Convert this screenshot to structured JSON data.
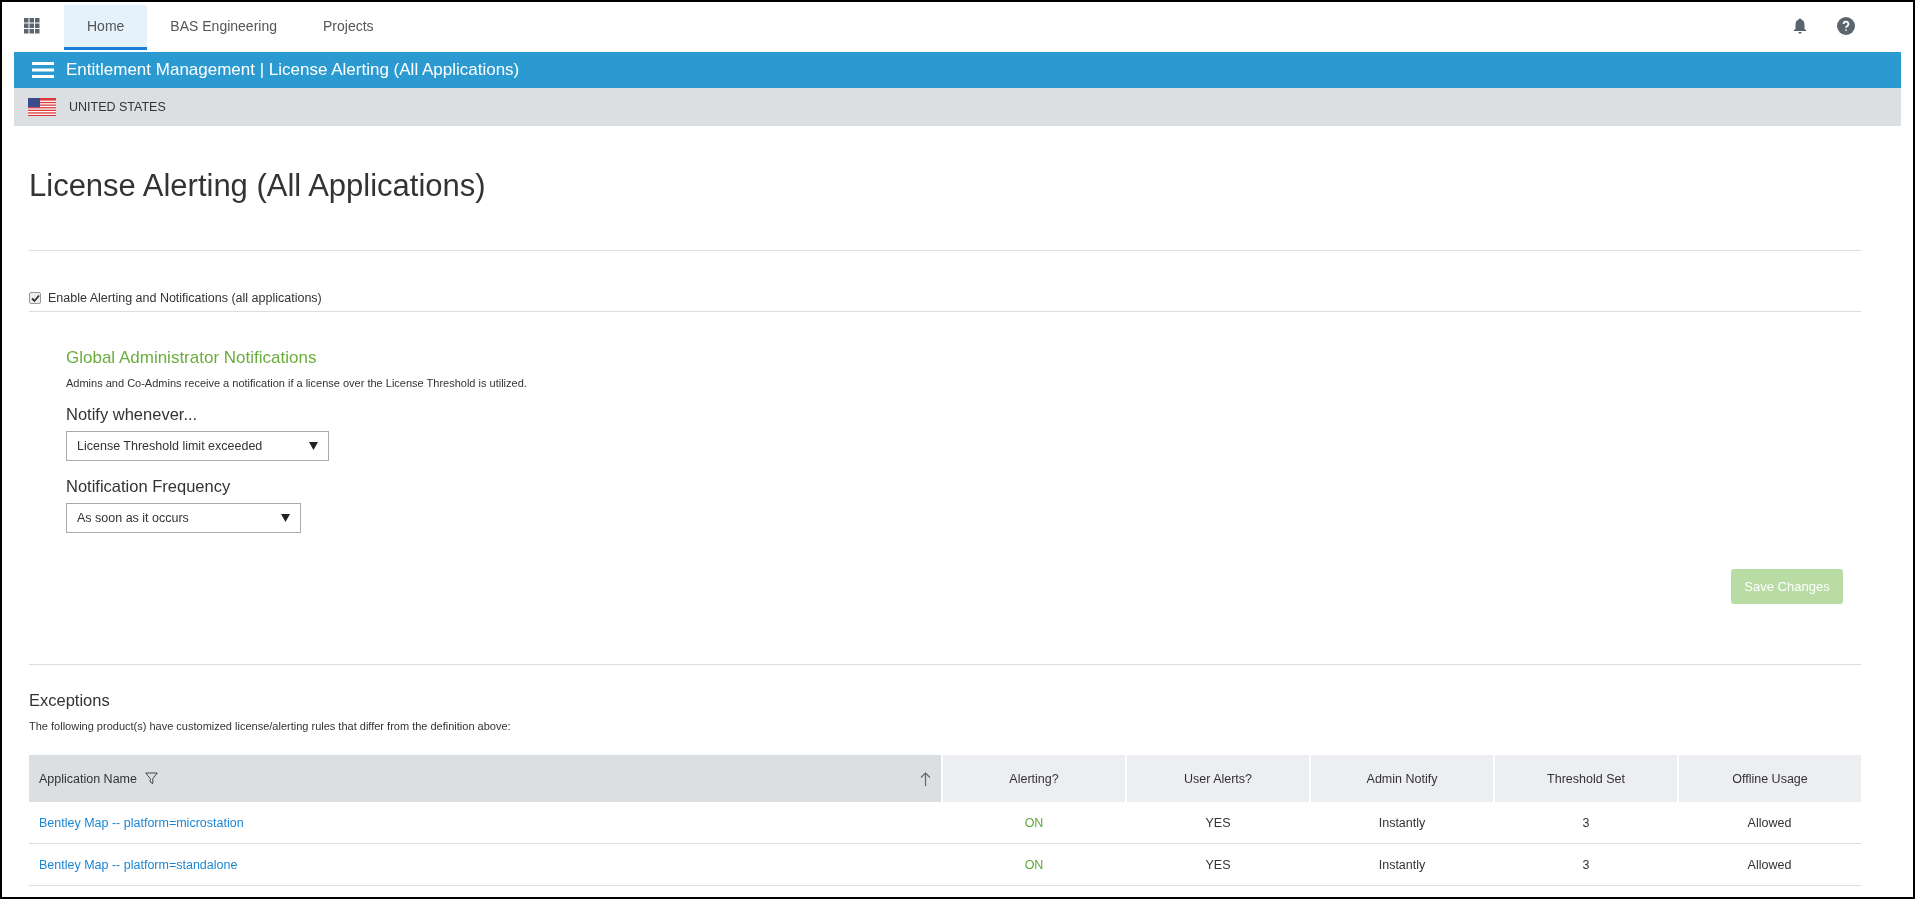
{
  "top_nav": {
    "tabs": [
      {
        "label": "Home",
        "selected": true
      },
      {
        "label": "BAS Engineering",
        "selected": false
      },
      {
        "label": "Projects",
        "selected": false
      }
    ]
  },
  "header_bar": {
    "title": "Entitlement Management | License Alerting (All Applications)"
  },
  "region_bar": {
    "label": "UNITED STATES"
  },
  "page_title": "License Alerting (All Applications)",
  "enable_alerting": {
    "label": "Enable Alerting and Notifications (all applications)",
    "checked": true
  },
  "global_notifications": {
    "heading": "Global Administrator Notifications",
    "description": "Admins and Co-Admins receive a notification if a license over the License Threshold is utilized.",
    "fields": [
      {
        "label": "Notify whenever...",
        "value": "License Threshold limit exceeded"
      },
      {
        "label": "Notification Frequency",
        "value": "As soon as it occurs"
      }
    ]
  },
  "save_button": {
    "label": "Save Changes",
    "disabled": true
  },
  "exceptions": {
    "heading": "Exceptions",
    "description": "The following product(s) have customized license/alerting rules that differ from the definition above:",
    "columns": [
      "Application Name",
      "Alerting?",
      "User Alerts?",
      "Admin Notify",
      "Threshold Set",
      "Offline Usage"
    ],
    "rows": [
      {
        "application": "Bentley Map -- platform=microstation",
        "alerting": "ON",
        "alerting_on": true,
        "user_alerts": "YES",
        "admin_notify": "Instantly",
        "threshold": "3",
        "offline": "Allowed"
      },
      {
        "application": "Bentley Map -- platform=standalone",
        "alerting": "ON",
        "alerting_on": true,
        "user_alerts": "YES",
        "admin_notify": "Instantly",
        "threshold": "3",
        "offline": "Allowed"
      }
    ]
  }
}
